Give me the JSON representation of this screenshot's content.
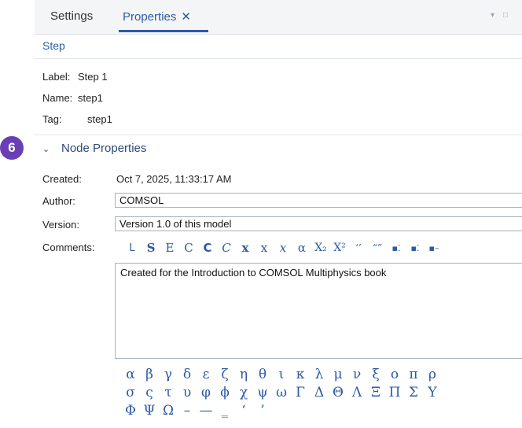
{
  "tabs": {
    "settings": "Settings",
    "properties": "Properties",
    "close_glyph": "✕"
  },
  "window_controls": [
    "▾",
    "□"
  ],
  "section": {
    "title": "Step",
    "label_key": "Label:",
    "label_val": "Step 1",
    "name_key": "Name:",
    "name_val": "step1",
    "tag_key": "Tag:",
    "tag_val": "step1"
  },
  "badge": "6",
  "node_properties": {
    "chevron": "⌄",
    "title": "Node Properties",
    "created_key": "Created:",
    "created_val": "Oct 7, 2025, 11:33:17 AM",
    "author_key": "Author:",
    "author_val": "COMSOL",
    "version_key": "Version:",
    "version_val": "Version 1.0 of this model",
    "comments_key": "Comments:",
    "comments_val": "Created for the Introduction to COMSOL Multiphysics book"
  },
  "toolbar": [
    "L",
    "S",
    "E",
    "C",
    "C",
    "C",
    "x",
    "x",
    "x",
    "α",
    "X₂",
    "X²",
    "‘’",
    "“”",
    "▪⁚",
    "▪⁚",
    "▪–"
  ],
  "symbols": {
    "row1": [
      "α",
      "β",
      "γ",
      "δ",
      "ε",
      "ζ",
      "η",
      "θ",
      "ι",
      "κ",
      "λ",
      "μ",
      "ν",
      "ξ",
      "ο",
      "π",
      "ρ"
    ],
    "row2": [
      "σ",
      "ς",
      "τ",
      "υ",
      "φ",
      "ϕ",
      "χ",
      "ψ",
      "ω",
      "Γ",
      "Δ",
      "Θ",
      "Λ",
      "Ξ",
      "Π",
      "Σ",
      "Υ"
    ],
    "row3": [
      "Φ",
      "Ψ",
      "Ω",
      "–",
      "—",
      "‗",
      "‘",
      "’"
    ]
  },
  "colors": {
    "accent": "#2d5aa6",
    "badge": "#6a3fb5"
  }
}
